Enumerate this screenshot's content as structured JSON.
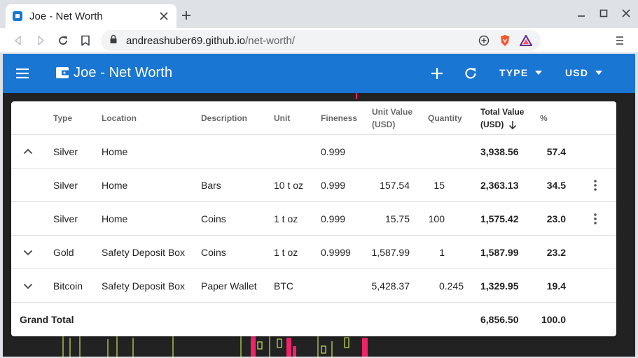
{
  "browser": {
    "tab_title": "Joe - Net Worth",
    "url_domain": "andreashuber69.github.io",
    "url_path": "/net-worth/"
  },
  "appbar": {
    "title": "Joe - Net Worth",
    "type_dropdown": "TYPE",
    "currency_dropdown": "USD",
    "color": "#1976d2"
  },
  "table": {
    "headers": {
      "type": "Type",
      "location": "Location",
      "description": "Description",
      "unit": "Unit",
      "fineness": "Fineness",
      "unit_value": "Unit Value",
      "unit_value_currency": "(USD)",
      "quantity": "Quantity",
      "total_value": "Total Value",
      "total_value_currency": "(USD)",
      "percent": "%"
    },
    "rows": [
      {
        "expander": "chevron-up",
        "type": "Silver",
        "location": "Home",
        "description": "",
        "unit": "",
        "fineness": "0.999",
        "unit_value": "",
        "quantity": "",
        "total_value": "3,938.56",
        "percent": "57.4",
        "menu": false
      },
      {
        "expander": "",
        "type": "Silver",
        "location": "Home",
        "description": "Bars",
        "unit": "10 t oz",
        "fineness": "0.999",
        "unit_value": "157.54",
        "quantity": "15",
        "total_value": "2,363.13",
        "percent": "34.5",
        "menu": true
      },
      {
        "expander": "",
        "type": "Silver",
        "location": "Home",
        "description": "Coins",
        "unit": "1 t oz",
        "fineness": "0.999",
        "unit_value": "15.75",
        "quantity": "100",
        "total_value": "1,575.42",
        "percent": "23.0",
        "menu": true
      },
      {
        "expander": "chevron-down",
        "type": "Gold",
        "location": "Safety Deposit Box",
        "description": "Coins",
        "unit": "1 t oz",
        "fineness": "0.9999",
        "unit_value": "1,587.99",
        "quantity": "1",
        "total_value": "1,587.99",
        "percent": "23.2",
        "menu": false
      },
      {
        "expander": "chevron-down",
        "type": "Bitcoin",
        "location": "Safety Deposit Box",
        "description": "Paper Wallet",
        "unit": "BTC",
        "fineness": "",
        "unit_value": "5,428.37",
        "quantity": "0.245",
        "total_value": "1,329.95",
        "percent": "19.4",
        "menu": false
      }
    ],
    "grand_total": {
      "label": "Grand Total",
      "total_value": "6,856.50",
      "percent": "100.0"
    }
  }
}
